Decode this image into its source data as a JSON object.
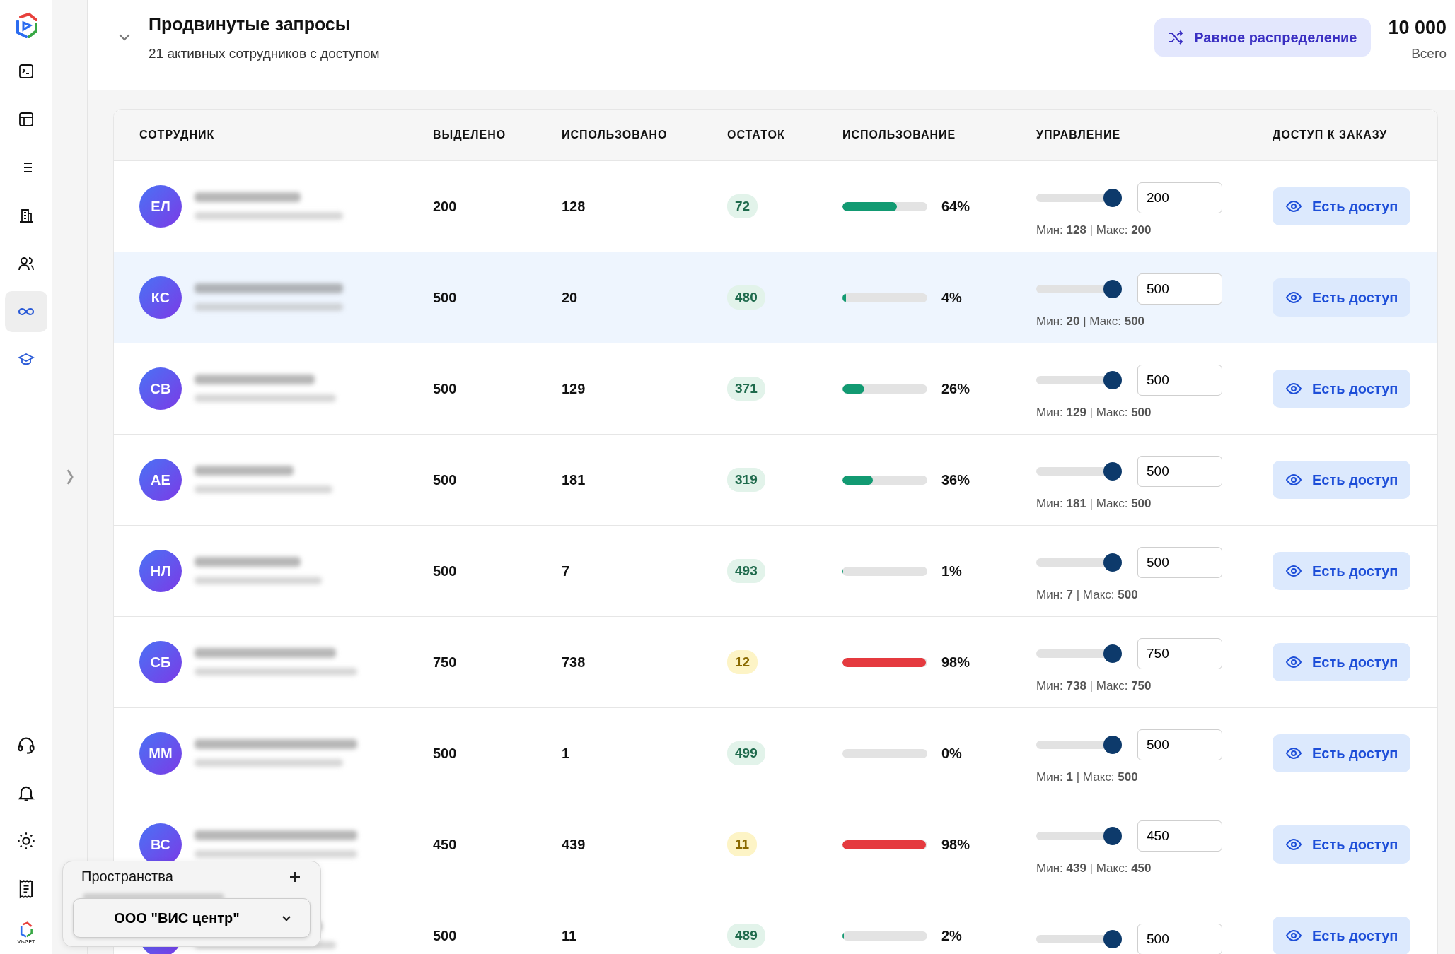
{
  "sidebar": {
    "items": [
      {
        "selected": false
      },
      {
        "selected": false
      },
      {
        "selected": false
      },
      {
        "selected": false
      },
      {
        "selected": false
      },
      {
        "selected": true
      },
      {
        "selected": false
      }
    ],
    "brand_caption": "VisGPT"
  },
  "header": {
    "title": "Продвинутые запросы",
    "subtitle": "21 активных сотрудников с доступом",
    "action_button": "Равное распределение",
    "total": "10 000",
    "total_label": "Всего"
  },
  "table": {
    "columns": [
      "СОТРУДНИК",
      "ВЫДЕЛЕНО",
      "ИСПОЛЬЗОВАНО",
      "ОСТАТОК",
      "ИСПОЛЬЗОВАНИЕ",
      "УПРАВЛЕНИЕ",
      "ДОСТУП К ЗАКАЗУ"
    ],
    "rows": [
      {
        "initials": "ЕЛ",
        "allocated": "200",
        "used": "128",
        "remaining": "72",
        "kind": "normal",
        "usage": {
          "text": "64%",
          "level": 0.64
        },
        "limit": {
          "value": "200",
          "level": 1
        },
        "range": "Мин: **128** | Макс: **200**",
        "access": "Есть доступ",
        "selected": false
      },
      {
        "initials": "КС",
        "allocated": "500",
        "used": "20",
        "remaining": "480",
        "kind": "normal",
        "usage": {
          "text": "4%",
          "level": 0.04
        },
        "limit": {
          "value": "500",
          "level": 1
        },
        "range": "Мин: **20** | Макс: **500**",
        "access": "Есть доступ",
        "selected": true
      },
      {
        "initials": "СВ",
        "allocated": "500",
        "used": "129",
        "remaining": "371",
        "kind": "normal",
        "usage": {
          "text": "26%",
          "level": 0.26
        },
        "limit": {
          "value": "500",
          "level": 1
        },
        "range": "Мин: **129** | Макс: **500**",
        "access": "Есть доступ",
        "selected": false
      },
      {
        "initials": "АЕ",
        "allocated": "500",
        "used": "181",
        "remaining": "319",
        "kind": "normal",
        "usage": {
          "text": "36%",
          "level": 0.36
        },
        "limit": {
          "value": "500",
          "level": 1
        },
        "range": "Мин: **181** | Макс: **500**",
        "access": "Есть доступ",
        "selected": false
      },
      {
        "initials": "НЛ",
        "allocated": "500",
        "used": "7",
        "remaining": "493",
        "kind": "normal",
        "usage": {
          "text": "1%",
          "level": 0.01
        },
        "limit": {
          "value": "500",
          "level": 1
        },
        "range": "Мин: **7** | Макс: **500**",
        "access": "Есть доступ",
        "selected": false
      },
      {
        "initials": "СБ",
        "allocated": "750",
        "used": "738",
        "remaining": "12",
        "kind": "warning",
        "usage": {
          "text": "98%",
          "level": 0.98
        },
        "limit": {
          "value": "750",
          "level": 1
        },
        "range": "Мин: **738** | Макс: **750**",
        "access": "Есть доступ",
        "selected": false
      },
      {
        "initials": "ММ",
        "allocated": "500",
        "used": "1",
        "remaining": "499",
        "kind": "normal",
        "usage": {
          "text": "0%",
          "level": 0
        },
        "limit": {
          "value": "500",
          "level": 1
        },
        "range": "Мин: **1** | Макс: **500**",
        "access": "Есть доступ",
        "selected": false
      },
      {
        "initials": "ВС",
        "allocated": "450",
        "used": "439",
        "remaining": "11",
        "kind": "warning",
        "usage": {
          "text": "98%",
          "level": 0.98
        },
        "limit": {
          "value": "450",
          "level": 1
        },
        "range": "Мин: **439** | Макс: **450**",
        "access": "Есть доступ",
        "selected": false
      },
      {
        "allocated": "500",
        "used": "11",
        "remaining": "489",
        "kind": "normal",
        "usage": {
          "text": "2%",
          "level": 0.02
        },
        "limit": {
          "value": "500",
          "level": 1
        },
        "access": "Есть доступ",
        "selected": false
      }
    ]
  },
  "spaces_popup": {
    "title": "Пространства",
    "workspace": "ООО \"ВИС центр\""
  }
}
